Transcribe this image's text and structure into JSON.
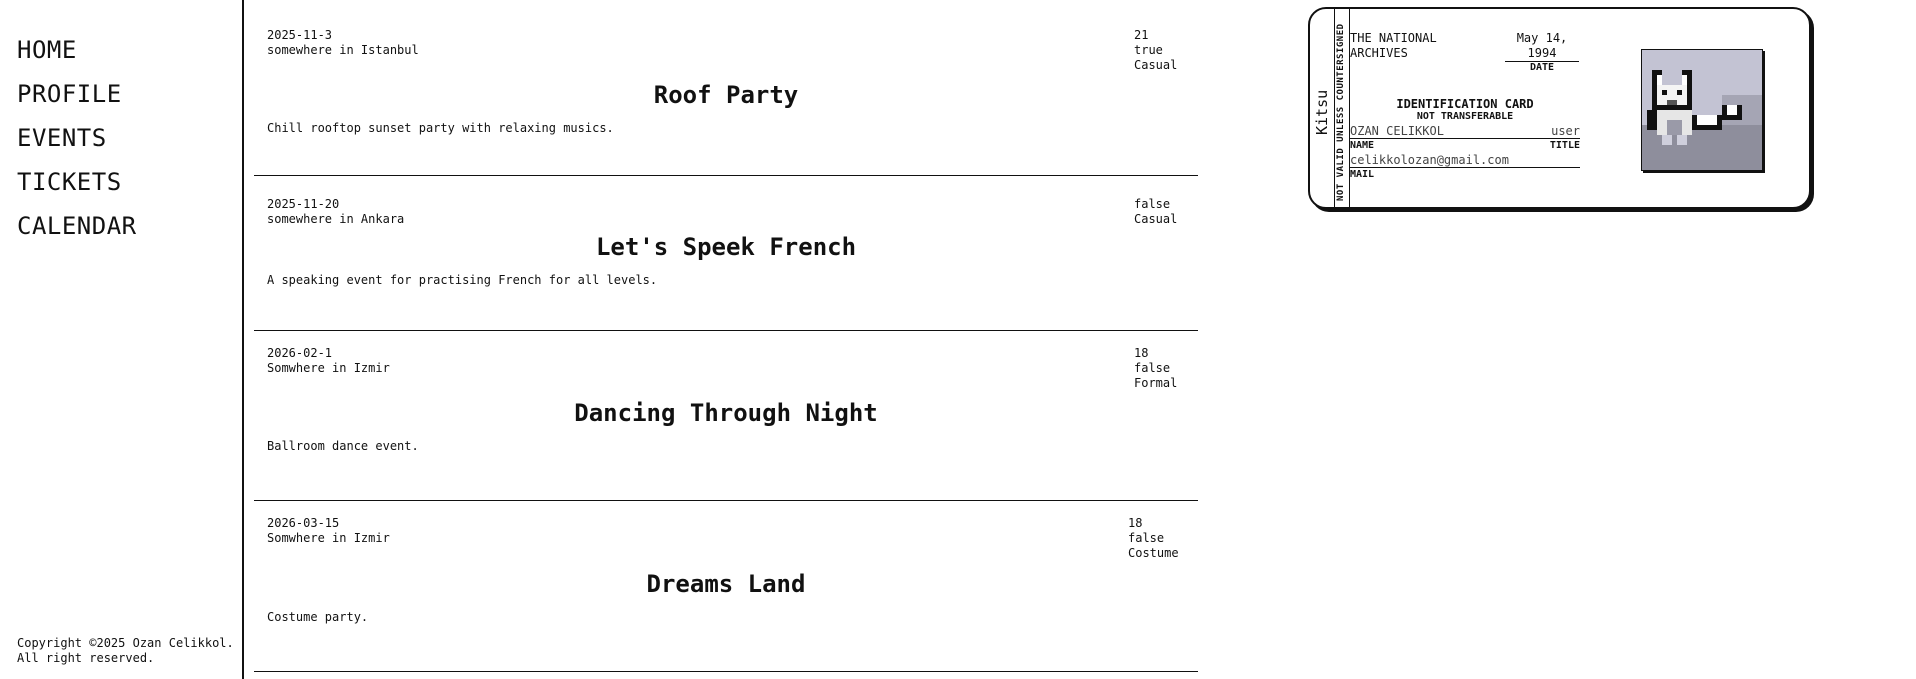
{
  "nav": {
    "items": [
      {
        "label": "HOME"
      },
      {
        "label": "PROFILE"
      },
      {
        "label": "EVENTS"
      },
      {
        "label": "TICKETS"
      },
      {
        "label": "CALENDAR"
      }
    ]
  },
  "footer": {
    "copyright": "Copyright ©2025 Ozan Celikkol.\nAll right reserved."
  },
  "events": [
    {
      "date": "2025-11-3",
      "location": "somewhere in Istanbul",
      "age": "21",
      "flag": "true",
      "dress": "Casual",
      "title": "Roof Party",
      "description": "Chill rooftop sunset party with relaxing musics."
    },
    {
      "date": "2025-11-20",
      "location": "somewhere in Ankara",
      "age": "",
      "flag": "false",
      "dress": "Casual",
      "title": "Let's Speek French",
      "description": "A speaking event for practising French for all levels."
    },
    {
      "date": "2026-02-1",
      "location": "Somwhere in Izmir",
      "age": "18",
      "flag": "false",
      "dress": "Formal",
      "title": "Dancing Through Night",
      "description": "Ballroom dance event."
    },
    {
      "date": "2026-03-15",
      "location": "Somwhere in Izmir",
      "age": "18",
      "flag": "false",
      "dress": "Costume",
      "title": "Dreams Land",
      "description": "Costume party."
    }
  ],
  "id_card": {
    "brand": "Kitsu",
    "strip_text": "NOT VALID UNLESS COUNTERSIGNED",
    "agency": "THE NATIONAL\nARCHIVES",
    "date_value": "May 14,\n1994",
    "date_label": "DATE",
    "card_title": "IDENTIFICATION CARD",
    "card_subtitle": "NOT TRANSFERABLE",
    "name_value": "OZAN CELIKKOL",
    "title_value": "user",
    "name_label": "NAME",
    "title_label": "TITLE",
    "mail_value": "celikkolozan@gmail.com",
    "mail_label": "MAIL",
    "photo_icon": "pixel-fox-icon"
  }
}
